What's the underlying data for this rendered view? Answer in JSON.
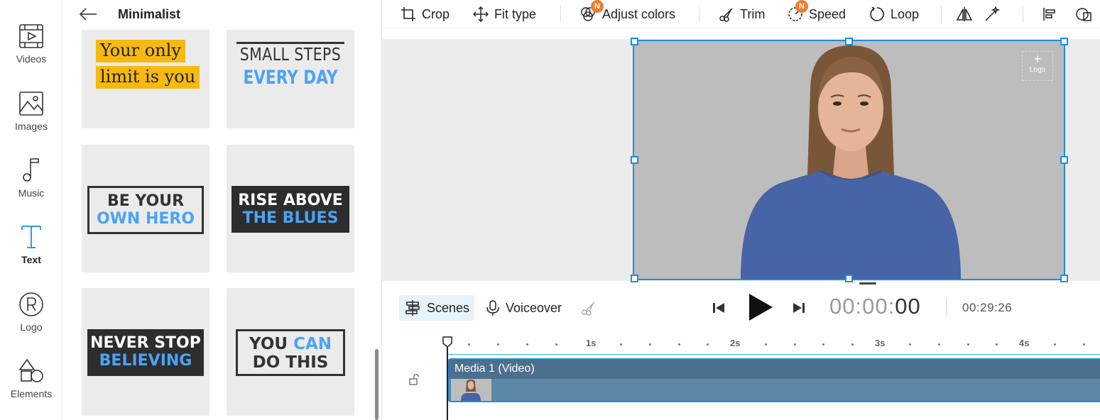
{
  "rail": {
    "items": [
      {
        "label": "Videos"
      },
      {
        "label": "Images"
      },
      {
        "label": "Music"
      },
      {
        "label": "Text"
      },
      {
        "label": "Logo"
      },
      {
        "label": "Elements"
      }
    ]
  },
  "panel": {
    "title": "Minimalist",
    "templates": [
      {
        "line1": "Your only",
        "line2": "limit is you"
      },
      {
        "line1": "SMALL STEPS",
        "line2": "EVERY DAY"
      },
      {
        "line1": "BE YOUR",
        "line2": "OWN HERO"
      },
      {
        "line1": "RISE ABOVE",
        "line2": "THE BLUES"
      },
      {
        "line1": "NEVER STOP",
        "line2": "BELIEVING"
      },
      {
        "line1a": "YOU",
        "line1b": "CAN",
        "line2": "DO THIS"
      }
    ]
  },
  "toolbar": {
    "crop": "Crop",
    "fit_type": "Fit type",
    "adjust_colors": "Adjust colors",
    "trim": "Trim",
    "speed": "Speed",
    "loop": "Loop",
    "new_badge": "N"
  },
  "canvas": {
    "logo_slot": "Logo",
    "logo_plus": "+"
  },
  "controls": {
    "scenes": "Scenes",
    "voiceover": "Voiceover",
    "time_current_dim": "00:00:",
    "time_current_hi": "00",
    "time_total": "00:29:26"
  },
  "timeline": {
    "ticks": [
      "1s",
      "2s",
      "3s",
      "4s"
    ],
    "track_title": "Media 1 (Video)"
  },
  "colors": {
    "accent": "#1a8fe0",
    "highlight_yellow": "#f6b90f",
    "title_blue": "#4ba3f5",
    "badge_orange": "#f07d2a"
  }
}
